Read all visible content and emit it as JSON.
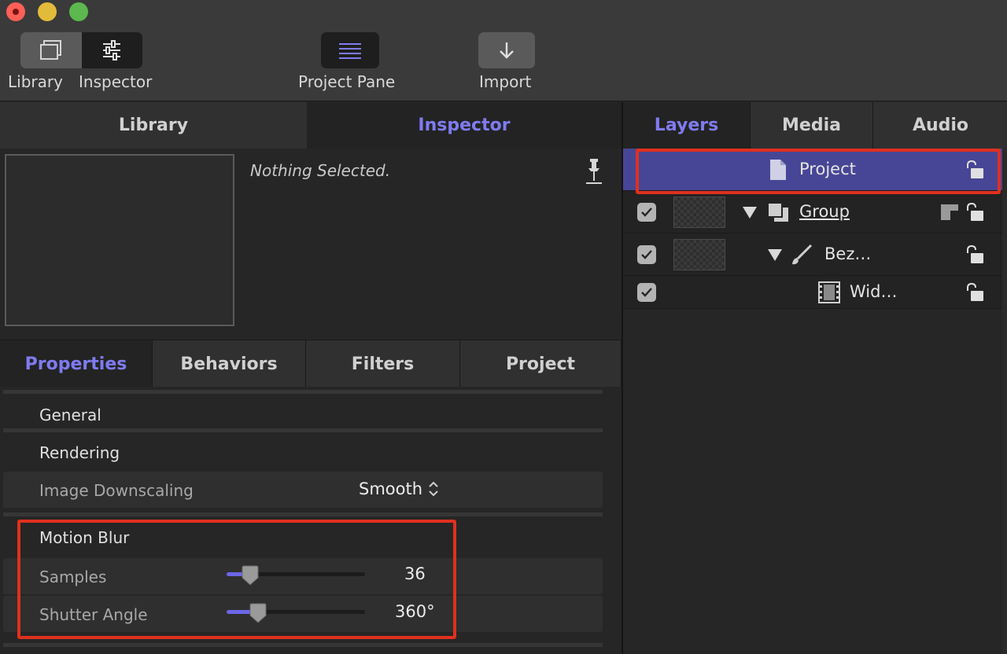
{
  "toolbar": {
    "library_label": "Library",
    "inspector_label": "Inspector",
    "project_pane_label": "Project Pane",
    "import_label": "Import"
  },
  "left_panel": {
    "tabs": [
      {
        "label": "Library",
        "active": false
      },
      {
        "label": "Inspector",
        "active": true
      }
    ],
    "nothing_selected": "Nothing Selected.",
    "sub_tabs": [
      {
        "label": "Properties",
        "active": true
      },
      {
        "label": "Behaviors",
        "active": false
      },
      {
        "label": "Filters",
        "active": false
      },
      {
        "label": "Project",
        "active": false
      }
    ],
    "sections": {
      "general": "General",
      "rendering": "Rendering",
      "image_downscaling_label": "Image Downscaling",
      "image_downscaling_value": "Smooth",
      "motion_blur": "Motion Blur",
      "samples_label": "Samples",
      "samples_value": "36",
      "samples_slider_fraction": 0.17,
      "shutter_angle_label": "Shutter Angle",
      "shutter_angle_value": "360°",
      "shutter_slider_fraction": 0.23
    }
  },
  "right_panel": {
    "tabs": [
      {
        "label": "Layers",
        "active": true
      },
      {
        "label": "Media",
        "active": false
      },
      {
        "label": "Audio",
        "active": false
      }
    ],
    "layers": [
      {
        "name": "Project",
        "selected": true
      },
      {
        "name": "Group",
        "checked": true
      },
      {
        "name": "Bez…",
        "checked": true
      },
      {
        "name": "Wid…",
        "checked": true
      }
    ]
  },
  "colors": {
    "accent": "#7f7bf0",
    "selection": "#474696",
    "highlight": "#e0301e"
  }
}
